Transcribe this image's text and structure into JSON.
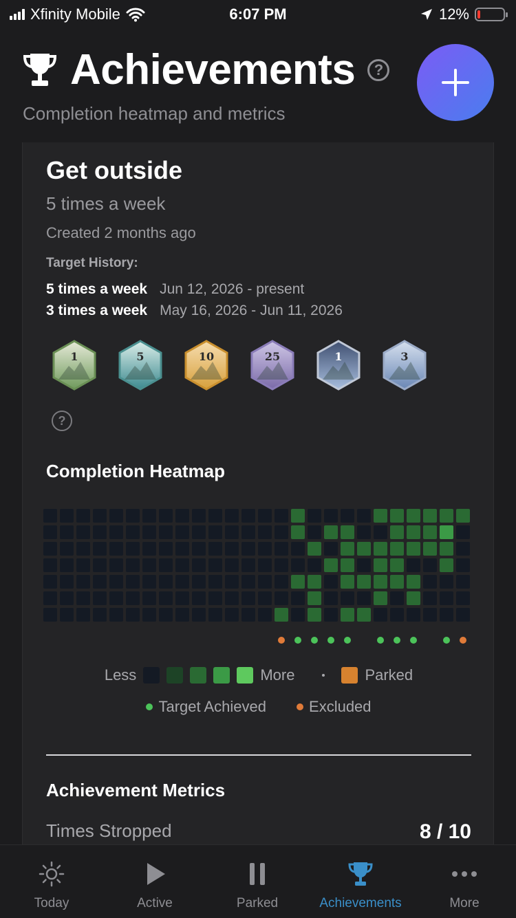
{
  "status_bar": {
    "carrier": "Xfinity Mobile",
    "time": "6:07 PM",
    "battery": "12%",
    "battery_level": 0.12,
    "battery_color": "#ff3b30"
  },
  "header": {
    "title": "Achievements",
    "subtitle": "Completion heatmap and metrics",
    "icon": "trophy-icon",
    "help_icon": "question-circle-icon",
    "add_icon": "plus-icon"
  },
  "goal": {
    "title": "Get outside",
    "frequency": "5 times a week",
    "created": "Created 2 months ago",
    "target_history_label": "Target History:",
    "target_history": [
      {
        "target": "5 times a week",
        "range": "Jun 12, 2026 - present"
      },
      {
        "target": "3 times a week",
        "range": "May 16, 2026 - Jun 11, 2026"
      }
    ]
  },
  "badges": [
    {
      "number": "1",
      "theme": "forest",
      "colors": [
        "#e6ead8",
        "#6f9a5c"
      ],
      "border": "#6a8f55"
    },
    {
      "number": "5",
      "theme": "waves",
      "colors": [
        "#dbeee9",
        "#3d8a90"
      ],
      "border": "#4a8f8f"
    },
    {
      "number": "10",
      "theme": "balloon",
      "colors": [
        "#f6ddb0",
        "#d7a03c"
      ],
      "border": "#c98f2e"
    },
    {
      "number": "25",
      "theme": "night-mountain",
      "colors": [
        "#cfc7e6",
        "#7a6aa8"
      ],
      "border": "#8a7cb8"
    },
    {
      "number": "1",
      "theme": "snow-peak",
      "colors": [
        "#3f4f70",
        "#a8bede"
      ],
      "border": "#c0c8d6"
    },
    {
      "number": "3",
      "theme": "diamond-peak",
      "colors": [
        "#d6e0ee",
        "#6a87b5"
      ],
      "border": "#9aaac6"
    }
  ],
  "heatmap": {
    "title": "Completion Heatmap",
    "level_colors": [
      "#141a24",
      "#1d4326",
      "#2a6a33",
      "#3b9a46",
      "#5ec95e"
    ],
    "grid": [
      [
        0,
        0,
        0,
        0,
        0,
        0,
        0,
        0,
        0,
        0,
        0,
        0,
        0,
        0,
        0,
        2,
        0,
        0,
        0,
        0,
        2,
        2,
        2,
        2,
        2,
        2
      ],
      [
        0,
        0,
        0,
        0,
        0,
        0,
        0,
        0,
        0,
        0,
        0,
        0,
        0,
        0,
        0,
        2,
        0,
        2,
        2,
        0,
        0,
        2,
        2,
        2,
        3,
        0
      ],
      [
        0,
        0,
        0,
        0,
        0,
        0,
        0,
        0,
        0,
        0,
        0,
        0,
        0,
        0,
        0,
        0,
        2,
        0,
        2,
        2,
        2,
        2,
        2,
        2,
        2,
        0
      ],
      [
        0,
        0,
        0,
        0,
        0,
        0,
        0,
        0,
        0,
        0,
        0,
        0,
        0,
        0,
        0,
        0,
        0,
        2,
        2,
        0,
        2,
        2,
        0,
        0,
        2,
        0
      ],
      [
        0,
        0,
        0,
        0,
        0,
        0,
        0,
        0,
        0,
        0,
        0,
        0,
        0,
        0,
        0,
        2,
        2,
        0,
        2,
        2,
        2,
        2,
        2,
        0,
        0,
        0
      ],
      [
        0,
        0,
        0,
        0,
        0,
        0,
        0,
        0,
        0,
        0,
        0,
        0,
        0,
        0,
        0,
        0,
        2,
        0,
        0,
        0,
        2,
        0,
        2,
        0,
        0,
        0
      ],
      [
        0,
        0,
        0,
        0,
        0,
        0,
        0,
        0,
        0,
        0,
        0,
        0,
        0,
        0,
        2,
        0,
        2,
        0,
        2,
        2,
        0,
        0,
        0,
        0,
        0,
        0
      ]
    ],
    "week_markers": [
      null,
      null,
      null,
      null,
      null,
      null,
      null,
      null,
      null,
      null,
      null,
      null,
      null,
      null,
      "excluded",
      "achieved",
      "achieved",
      "achieved",
      "achieved",
      null,
      "achieved",
      "achieved",
      "achieved",
      null,
      "achieved",
      "excluded"
    ],
    "marker_colors": {
      "achieved": "#4cc35a",
      "excluded": "#e07b39"
    },
    "parked_color": "#d7822f",
    "legend": {
      "less": "Less",
      "more": "More",
      "parked": "Parked",
      "target_achieved": "Target Achieved",
      "excluded": "Excluded"
    }
  },
  "metrics": {
    "title": "Achievement Metrics",
    "rows": [
      {
        "label": "Times Stropped",
        "value": "8 / 10"
      }
    ]
  },
  "tabs": [
    {
      "label": "Today",
      "icon": "sun-icon",
      "active": false
    },
    {
      "label": "Active",
      "icon": "play-icon",
      "active": false
    },
    {
      "label": "Parked",
      "icon": "pause-icon",
      "active": false
    },
    {
      "label": "Achievements",
      "icon": "trophy-icon",
      "active": true
    },
    {
      "label": "More",
      "icon": "more-dots-icon",
      "active": false
    }
  ],
  "accent_color": "#3a8fc9"
}
